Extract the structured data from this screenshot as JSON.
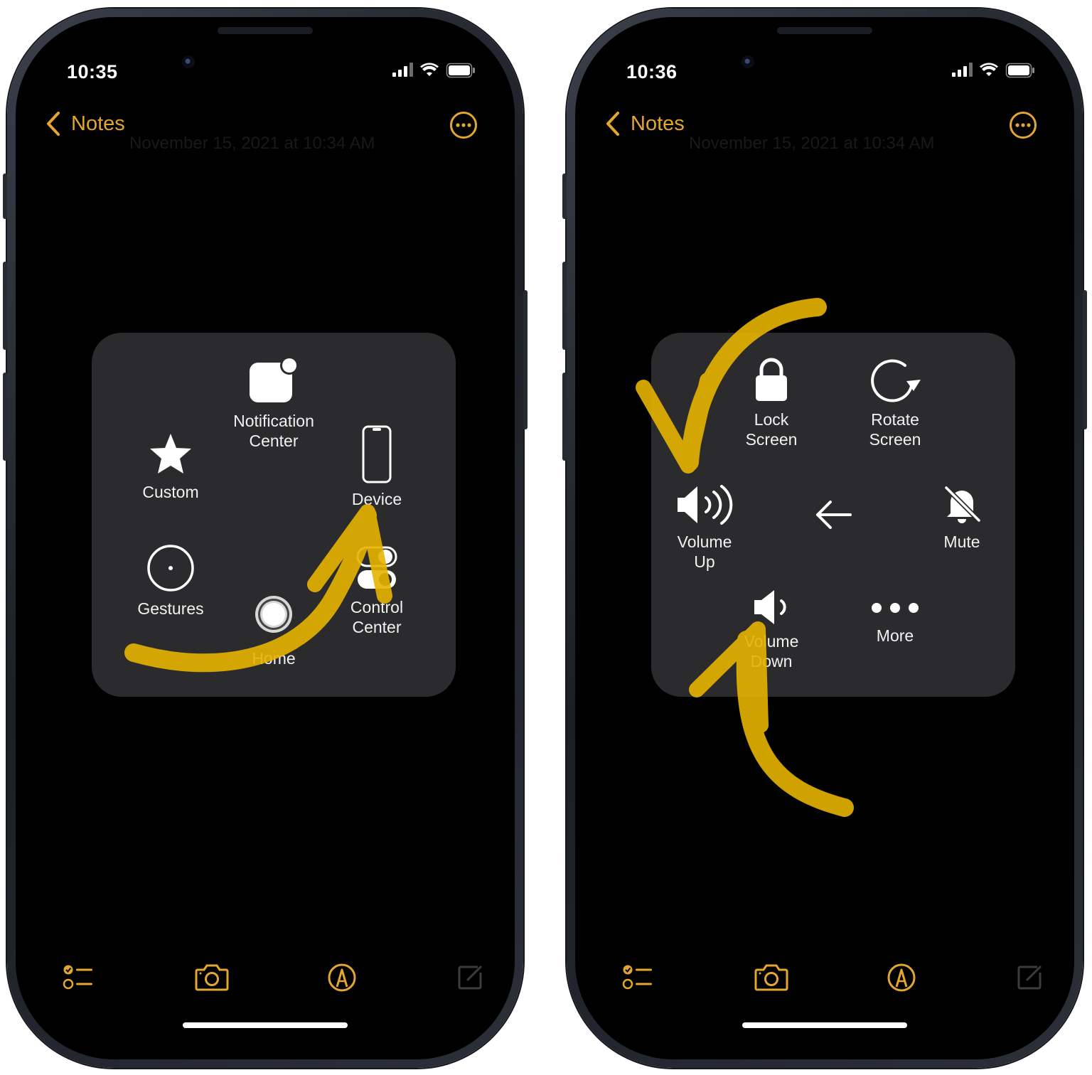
{
  "left": {
    "status": {
      "time": "10:35"
    },
    "nav": {
      "back_label": "Notes",
      "date_ghost": "November 15, 2021 at 10:34 AM"
    },
    "menu": {
      "notification_center": "Notification\nCenter",
      "custom": "Custom",
      "device": "Device",
      "gestures": "Gestures",
      "home": "Home",
      "control_center": "Control\nCenter"
    }
  },
  "right": {
    "status": {
      "time": "10:36"
    },
    "nav": {
      "back_label": "Notes",
      "date_ghost": "November 15, 2021 at 10:34 AM"
    },
    "menu": {
      "lock_screen": "Lock\nScreen",
      "rotate_screen": "Rotate\nScreen",
      "volume_up": "Volume\nUp",
      "mute": "Mute",
      "volume_down": "Volume\nDown",
      "more": "More"
    }
  },
  "colors": {
    "accent": "#e3a72f",
    "menu_bg": "#2b2b2d",
    "highlight": "#e6b400"
  }
}
